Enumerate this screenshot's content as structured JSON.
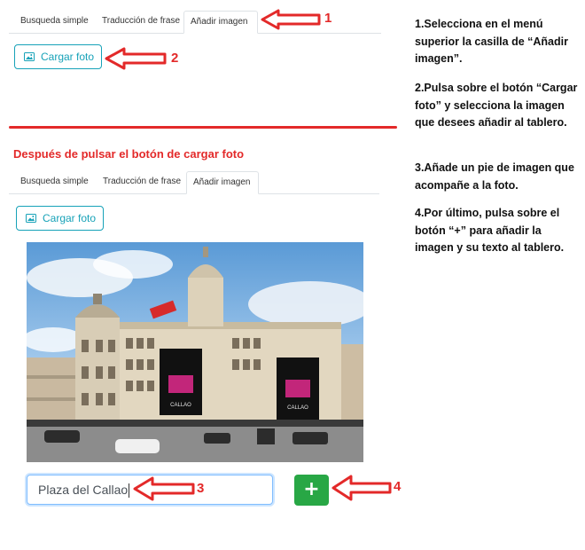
{
  "panel_top": {
    "tabs": [
      {
        "label": "Busqueda simple"
      },
      {
        "label": "Traducción de frase"
      },
      {
        "label": "Añadir imagen"
      }
    ],
    "upload_label": "Cargar foto"
  },
  "after_label": "Después de pulsar el botón de cargar foto",
  "panel_bottom": {
    "tabs": [
      {
        "label": "Busqueda simple"
      },
      {
        "label": "Traducción de frase"
      },
      {
        "label": "Añadir imagen"
      }
    ],
    "upload_label": "Cargar foto",
    "caption_value": "Plaza del Callao",
    "add_label": "+",
    "billboard_text": "CALLAO"
  },
  "markers": [
    "1",
    "2",
    "3",
    "4"
  ],
  "instructions": [
    "1.Selecciona en el menú superior la casilla de “Añadir imagen”.",
    "2.Pulsa sobre el botón “Cargar foto” y selecciona la imagen que desees añadir al tablero.",
    "3.Añade un pie de imagen que acompañe a la foto.",
    "4.Por último, pulsa sobre el botón “+” para añadir la imagen y su texto al tablero."
  ],
  "colors": {
    "accent_red": "#e32929",
    "teal": "#17a2b8",
    "green": "#28a745"
  }
}
